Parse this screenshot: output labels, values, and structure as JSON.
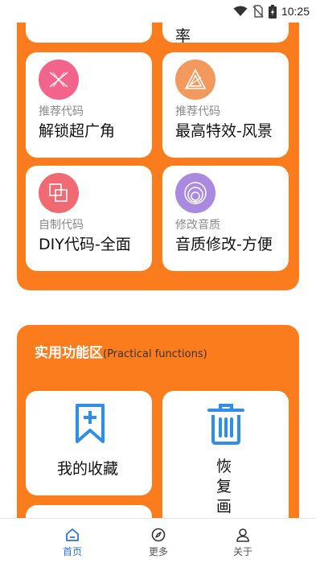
{
  "status_bar": {
    "time": "10:25"
  },
  "top_section": {
    "partial_card_text": "率",
    "cards": [
      {
        "subtitle": "推荐代码",
        "title": "解锁超广角",
        "icon": "fan-icon",
        "color": "#f2648c"
      },
      {
        "subtitle": "推荐代码",
        "title": "最高特效-风景",
        "icon": "triangle-icon",
        "color": "#f29a5e"
      },
      {
        "subtitle": "自制代码",
        "title": "DIY代码-全面",
        "icon": "squares-icon",
        "color": "#ef6a72"
      },
      {
        "subtitle": "修改音质",
        "title": "音质修改-方便",
        "icon": "rings-icon",
        "color": "#a98ae0"
      }
    ]
  },
  "utility_section": {
    "title": "实用功能区",
    "subtitle": "(Practical functions)",
    "items": [
      {
        "label": "我的收藏",
        "icon": "bookmark-add-icon"
      },
      {
        "label": "恢复画质",
        "icon": "trash-icon"
      }
    ]
  },
  "bottom_nav": {
    "items": [
      {
        "label": "首页",
        "icon": "home-icon",
        "active": true
      },
      {
        "label": "更多",
        "icon": "compass-icon",
        "active": false
      },
      {
        "label": "关于",
        "icon": "user-icon",
        "active": false
      }
    ]
  },
  "colors": {
    "accent_orange": "#fb7c1c",
    "icon_blue": "#2e8ee8",
    "nav_active": "#2f6fd6"
  }
}
